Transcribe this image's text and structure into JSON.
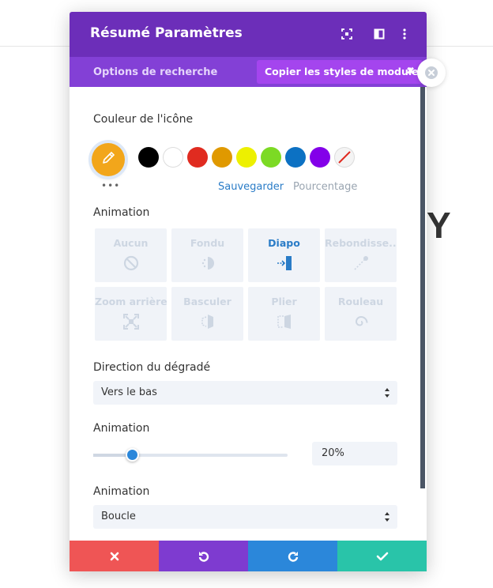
{
  "header": {
    "title": "Résumé Paramètres"
  },
  "tabs": {
    "search_label": "Options de recherche",
    "copy_label": "Copier les styles de module"
  },
  "icon_color": {
    "label": "Couleur de l'icône",
    "current": "#f2a61b",
    "swatches": [
      "#000000",
      "#ffffff",
      "#e02b20",
      "#e09900",
      "#edf000",
      "#7cda24",
      "#0c71c3",
      "#8300e9"
    ],
    "more": "•••",
    "save_label": "Sauvegarder",
    "percent_label": "Pourcentage"
  },
  "animation_style": {
    "label": "Animation",
    "tiles": [
      {
        "label": "Aucun"
      },
      {
        "label": "Fondu"
      },
      {
        "label": "Diapo"
      },
      {
        "label": "Rebondisse..."
      },
      {
        "label": "Zoom arrière"
      },
      {
        "label": "Basculer"
      },
      {
        "label": "Plier"
      },
      {
        "label": "Rouleau"
      }
    ],
    "selected": "Diapo"
  },
  "gradient_direction": {
    "label": "Direction du dégradé",
    "value": "Vers le bas"
  },
  "animation_slider": {
    "label": "Animation",
    "value": "20%",
    "percent": 20
  },
  "animation_repeat": {
    "label": "Animation",
    "value": "Boucle"
  },
  "background_letter": "Y",
  "colors": {
    "header": "#6c2eb9",
    "tabs": "#8340d6",
    "accent": "#2b87da",
    "cancel": "#ef5555",
    "undo": "#7e3bd0",
    "redo": "#2b87da",
    "save": "#29c4a9"
  }
}
